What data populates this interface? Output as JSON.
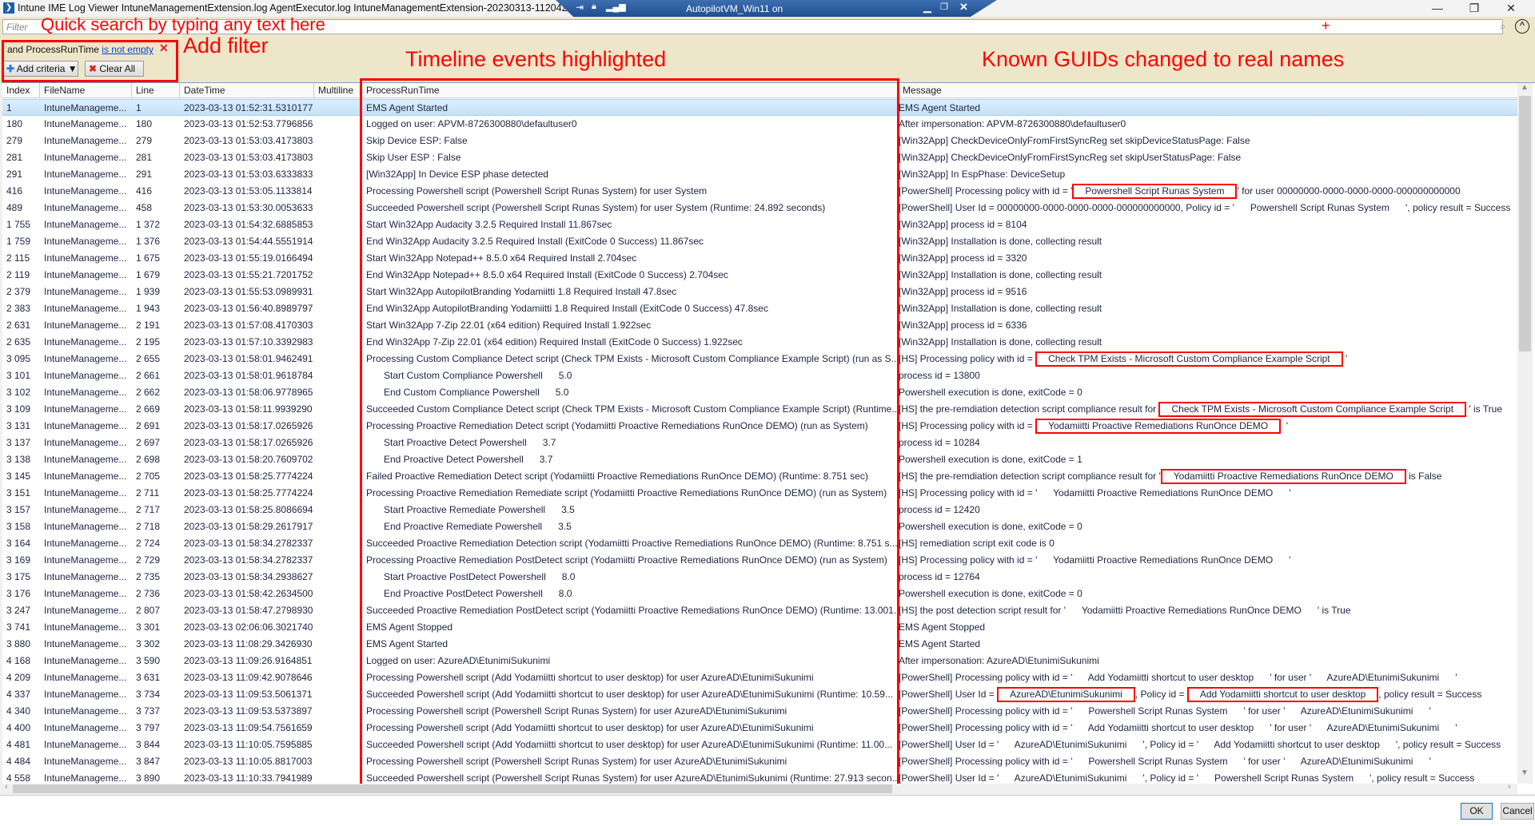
{
  "window": {
    "title": "Intune IME Log Viewer IntuneManagementExtension.log AgentExecutor.log IntuneManagementExtension-20230313-112042.log",
    "rdp_name": "AutopilotVM_Win11 on",
    "icons": [
      "app-icon",
      "pin-icon",
      "lock-icon",
      "signal-icon",
      "minimize-icon",
      "restore-icon",
      "close-icon"
    ]
  },
  "filter": {
    "placeholder": "Filter",
    "criteria_prefix": "and ProcessRunTime",
    "criteria_operator": "is not empty",
    "remove": "✕",
    "add_criteria": "Add criteria",
    "clear_all": "Clear All"
  },
  "annotations": {
    "search": "Quick search by typing any text here",
    "filter": "Add filter",
    "timeline": "Timeline events highlighted",
    "guids": "Known GUIDs changed to real names",
    "plus": "+",
    "color": "#ff0000"
  },
  "columns": [
    "Index",
    "FileName",
    "Line",
    "DateTime",
    "Multiline",
    "ProcessRunTime",
    "Message"
  ],
  "selected_row": 0,
  "rows": [
    [
      "1",
      "IntuneManageme...",
      "1",
      "2023-03-13 01:52:31.5310177",
      "",
      "EMS Agent Started",
      false,
      [
        "EMS Agent Started"
      ]
    ],
    [
      "180",
      "IntuneManageme...",
      "180",
      "2023-03-13 01:52:53.7796856",
      "",
      "Logged on user: APVM-8726300880\\defaultuser0",
      false,
      [
        "After impersonation: APVM-8726300880\\defaultuser0"
      ]
    ],
    [
      "279",
      "IntuneManageme...",
      "279",
      "2023-03-13 01:53:03.4173803",
      "",
      "Skip Device ESP: False",
      false,
      [
        "[Win32App] CheckDeviceOnlyFromFirstSyncReg set skipDeviceStatusPage: False"
      ]
    ],
    [
      "281",
      "IntuneManageme...",
      "281",
      "2023-03-13 01:53:03.4173803",
      "",
      "Skip User ESP : False",
      false,
      [
        "[Win32App] CheckDeviceOnlyFromFirstSyncReg set skipUserStatusPage: False"
      ]
    ],
    [
      "291",
      "IntuneManageme...",
      "291",
      "2023-03-13 01:53:03.6333833",
      "",
      "[Win32App] In Device ESP phase detected",
      false,
      [
        "[Win32App] In EspPhase: DeviceSetup"
      ]
    ],
    [
      "416",
      "IntuneManageme...",
      "416",
      "2023-03-13 01:53:05.1133814",
      "",
      "Processing Powershell script (Powershell Script Runas System) for user System",
      false,
      [
        "[PowerShell] Processing policy with id = '",
        {
          "box": "Powershell Script Runas System"
        },
        "' for user 00000000-0000-0000-0000-000000000000"
      ]
    ],
    [
      "489",
      "IntuneManageme...",
      "458",
      "2023-03-13 01:53:30.0053633",
      "",
      "Succeeded Powershell script (Powershell Script Runas System) for user System (Runtime: 24.892 seconds)",
      false,
      [
        "[PowerShell] User Id = 00000000-0000-0000-0000-000000000000, Policy id = '      Powershell Script Runas System      ', policy result = Success"
      ]
    ],
    [
      "1 755",
      "IntuneManageme...",
      "1 372",
      "2023-03-13 01:54:32.6885853",
      "",
      "Start Win32App Audacity 3.2.5 Required Install 11.867sec",
      false,
      [
        "[Win32App] process id = 8104"
      ]
    ],
    [
      "1 759",
      "IntuneManageme...",
      "1 376",
      "2023-03-13 01:54:44.5551914",
      "",
      "End Win32App Audacity 3.2.5 Required Install (ExitCode 0 Success) 11.867sec",
      false,
      [
        "[Win32App] Installation is done, collecting result"
      ]
    ],
    [
      "2 115",
      "IntuneManageme...",
      "1 675",
      "2023-03-13 01:55:19.0166494",
      "",
      "Start Win32App Notepad++ 8.5.0 x64 Required Install 2.704sec",
      false,
      [
        "[Win32App] process id = 3320"
      ]
    ],
    [
      "2 119",
      "IntuneManageme...",
      "1 679",
      "2023-03-13 01:55:21.7201752",
      "",
      "End Win32App Notepad++ 8.5.0 x64 Required Install (ExitCode 0 Success) 2.704sec",
      false,
      [
        "[Win32App] Installation is done, collecting result"
      ]
    ],
    [
      "2 379",
      "IntuneManageme...",
      "1 939",
      "2023-03-13 01:55:53.0989931",
      "",
      "Start Win32App AutopilotBranding Yodamiitti 1.8 Required Install 47.8sec",
      false,
      [
        "[Win32App] process id = 9516"
      ]
    ],
    [
      "2 383",
      "IntuneManageme...",
      "1 943",
      "2023-03-13 01:56:40.8989797",
      "",
      "End Win32App AutopilotBranding Yodamiitti 1.8 Required Install (ExitCode 0 Success) 47.8sec",
      false,
      [
        "[Win32App] Installation is done, collecting result"
      ]
    ],
    [
      "2 631",
      "IntuneManageme...",
      "2 191",
      "2023-03-13 01:57:08.4170303",
      "",
      "Start Win32App 7-Zip 22.01 (x64 edition) Required Install 1.922sec",
      false,
      [
        "[Win32App] process id = 6336"
      ]
    ],
    [
      "2 635",
      "IntuneManageme...",
      "2 195",
      "2023-03-13 01:57:10.3392983",
      "",
      "End Win32App 7-Zip 22.01 (x64 edition) Required Install (ExitCode 0 Success) 1.922sec",
      false,
      [
        "[Win32App] Installation is done, collecting result"
      ]
    ],
    [
      "3 095",
      "IntuneManageme...",
      "2 655",
      "2023-03-13 01:58:01.9462491",
      "",
      "Processing Custom Compliance Detect script (Check TPM Exists - Microsoft Custom Compliance Example Script) (run as S...",
      false,
      [
        "[HS] Processing policy with id = ",
        {
          "box": "Check TPM Exists - Microsoft Custom Compliance Example Script"
        },
        " '"
      ]
    ],
    [
      "3 101",
      "IntuneManageme...",
      "2 661",
      "2023-03-13 01:58:01.9618784",
      "",
      "Start Custom Compliance Powershell      5.0",
      true,
      [
        "process id = 13800"
      ]
    ],
    [
      "3 102",
      "IntuneManageme...",
      "2 662",
      "2023-03-13 01:58:06.9778965",
      "",
      "End Custom Compliance Powershell      5.0",
      true,
      [
        "Powershell execution is done, exitCode = 0"
      ]
    ],
    [
      "3 109",
      "IntuneManageme...",
      "2 669",
      "2023-03-13 01:58:11.9939290",
      "",
      "Succeeded Custom Compliance Detect script (Check TPM Exists - Microsoft Custom Compliance Example Script) (Runtime...",
      false,
      [
        "[HS] the pre-remdiation detection script compliance result for ",
        {
          "box": "Check TPM Exists - Microsoft Custom Compliance Example Script"
        },
        " ' is True"
      ]
    ],
    [
      "3 131",
      "IntuneManageme...",
      "2 691",
      "2023-03-13 01:58:17.0265926",
      "",
      "Processing Proactive Remediation Detect script (Yodamiitti Proactive Remediations RunOnce DEMO) (run as System)",
      false,
      [
        "[HS] Processing policy with id = ",
        {
          "box": "Yodamiitti Proactive Remediations RunOnce DEMO"
        },
        "  '"
      ]
    ],
    [
      "3 137",
      "IntuneManageme...",
      "2 697",
      "2023-03-13 01:58:17.0265926",
      "",
      "Start Proactive Detect Powershell      3.7",
      true,
      [
        "process id = 10284"
      ]
    ],
    [
      "3 138",
      "IntuneManageme...",
      "2 698",
      "2023-03-13 01:58:20.7609702",
      "",
      "End Proactive Detect Powershell      3.7",
      true,
      [
        "Powershell execution is done, exitCode = 1"
      ]
    ],
    [
      "3 145",
      "IntuneManageme...",
      "2 705",
      "2023-03-13 01:58:25.7774224",
      "",
      "Failed Proactive Remediation Detect script (Yodamiitti Proactive Remediations RunOnce DEMO) (Runtime: 8.751 sec)",
      false,
      [
        "[HS] the pre-remdiation detection script compliance result for '",
        {
          "box": "Yodamiitti Proactive Remediations RunOnce DEMO"
        },
        " is False"
      ]
    ],
    [
      "3 151",
      "IntuneManageme...",
      "2 711",
      "2023-03-13 01:58:25.7774224",
      "",
      "Processing Proactive Remediation Remediate script (Yodamiitti Proactive Remediations RunOnce DEMO) (run as System)",
      false,
      [
        "[HS] Processing policy with id = '      Yodamiitti Proactive Remediations RunOnce DEMO      '"
      ]
    ],
    [
      "3 157",
      "IntuneManageme...",
      "2 717",
      "2023-03-13 01:58:25.8086694",
      "",
      "Start Proactive Remediate Powershell      3.5",
      true,
      [
        "process id = 12420"
      ]
    ],
    [
      "3 158",
      "IntuneManageme...",
      "2 718",
      "2023-03-13 01:58:29.2617917",
      "",
      "End Proactive Remediate Powershell      3.5",
      true,
      [
        "Powershell execution is done, exitCode = 0"
      ]
    ],
    [
      "3 164",
      "IntuneManageme...",
      "2 724",
      "2023-03-13 01:58:34.2782337",
      "",
      "Succeeded Proactive Remediation Detection script (Yodamiitti Proactive Remediations RunOnce DEMO) (Runtime: 8.751 s...",
      false,
      [
        "[HS] remediation script exit code is 0"
      ]
    ],
    [
      "3 169",
      "IntuneManageme...",
      "2 729",
      "2023-03-13 01:58:34.2782337",
      "",
      "Processing Proactive Remediation PostDetect script (Yodamiitti Proactive Remediations RunOnce DEMO) (run as System)",
      false,
      [
        "[HS] Processing policy with id = '      Yodamiitti Proactive Remediations RunOnce DEMO      '"
      ]
    ],
    [
      "3 175",
      "IntuneManageme...",
      "2 735",
      "2023-03-13 01:58:34.2938627",
      "",
      "Start Proactive PostDetect Powershell      8.0",
      true,
      [
        "process id = 12764"
      ]
    ],
    [
      "3 176",
      "IntuneManageme...",
      "2 736",
      "2023-03-13 01:58:42.2634500",
      "",
      "End Proactive PostDetect Powershell      8.0",
      true,
      [
        "Powershell execution is done, exitCode = 0"
      ]
    ],
    [
      "3 247",
      "IntuneManageme...",
      "2 807",
      "2023-03-13 01:58:47.2798930",
      "",
      "Succeeded Proactive Remediation PostDetect script (Yodamiitti Proactive Remediations RunOnce DEMO) (Runtime: 13.001...",
      false,
      [
        "[HS] the post detection script result for '      Yodamiitti Proactive Remediations RunOnce DEMO      ' is True"
      ]
    ],
    [
      "3 741",
      "IntuneManageme...",
      "3 301",
      "2023-03-13 02:06:06.3021740",
      "",
      "EMS Agent Stopped",
      false,
      [
        "EMS Agent Stopped"
      ]
    ],
    [
      "3 880",
      "IntuneManageme...",
      "3 302",
      "2023-03-13 11:08:29.3426930",
      "",
      "EMS Agent Started",
      false,
      [
        "EMS Agent Started"
      ]
    ],
    [
      "4 168",
      "IntuneManageme...",
      "3 590",
      "2023-03-13 11:09:26.9164851",
      "",
      "Logged on user: AzureAD\\EtunimiSukunimi",
      false,
      [
        "After impersonation: AzureAD\\EtunimiSukunimi"
      ]
    ],
    [
      "4 209",
      "IntuneManageme...",
      "3 631",
      "2023-03-13 11:09:42.9078646",
      "",
      "Processing Powershell script (Add Yodamiitti shortcut to user desktop) for user AzureAD\\EtunimiSukunimi",
      false,
      [
        "[PowerShell] Processing policy with id = '      Add Yodamiitti shortcut to user desktop      ' for user '      AzureAD\\EtunimiSukunimi      '"
      ]
    ],
    [
      "4 337",
      "IntuneManageme...",
      "3 734",
      "2023-03-13 11:09:53.5061371",
      "",
      "Succeeded Powershell script (Add Yodamiitti shortcut to user desktop) for user AzureAD\\EtunimiSukunimi (Runtime: 10.59...",
      false,
      [
        "[PowerShell] User Id = ",
        {
          "box": "AzureAD\\EtunimiSukunimi"
        },
        ", Policy id = ",
        {
          "box": "Add Yodamiitti shortcut to user desktop"
        },
        ", policy result = Success"
      ]
    ],
    [
      "4 340",
      "IntuneManageme...",
      "3 737",
      "2023-03-13 11:09:53.5373897",
      "",
      "Processing Powershell script (Powershell Script Runas System) for user AzureAD\\EtunimiSukunimi",
      false,
      [
        "[PowerShell] Processing policy with id = '      Powershell Script Runas System      ' for user '      AzureAD\\EtunimiSukunimi      '"
      ]
    ],
    [
      "4 400",
      "IntuneManageme...",
      "3 797",
      "2023-03-13 11:09:54.7561659",
      "",
      "Processing Powershell script (Add Yodamiitti shortcut to user desktop) for user AzureAD\\EtunimiSukunimi",
      false,
      [
        "[PowerShell] Processing policy with id = '      Add Yodamiitti shortcut to user desktop      ' for user '      AzureAD\\EtunimiSukunimi      '"
      ]
    ],
    [
      "4 481",
      "IntuneManageme...",
      "3 844",
      "2023-03-13 11:10:05.7595885",
      "",
      "Succeeded Powershell script (Add Yodamiitti shortcut to user desktop) for user AzureAD\\EtunimiSukunimi (Runtime: 11.00...",
      false,
      [
        "[PowerShell] User Id = '      AzureAD\\EtunimiSukunimi      ', Policy id = '      Add Yodamiitti shortcut to user desktop      ', policy result = Success"
      ]
    ],
    [
      "4 484",
      "IntuneManageme...",
      "3 847",
      "2023-03-13 11:10:05.8817003",
      "",
      "Processing Powershell script (Powershell Script Runas System) for user AzureAD\\EtunimiSukunimi",
      false,
      [
        "[PowerShell] Processing policy with id = '      Powershell Script Runas System      ' for user '      AzureAD\\EtunimiSukunimi      '"
      ]
    ],
    [
      "4 558",
      "IntuneManageme...",
      "3 890",
      "2023-03-13 11:10:33.7941989",
      "",
      "Succeeded Powershell script (Powershell Script Runas System) for user AzureAD\\EtunimiSukunimi (Runtime: 27.913 secon...",
      false,
      [
        "[PowerShell] User Id = '      AzureAD\\EtunimiSukunimi      ', Policy id = '      Powershell Script Runas System      ', policy result = Success"
      ]
    ]
  ],
  "dialog": {
    "ok": "OK",
    "cancel": "Cancel"
  }
}
